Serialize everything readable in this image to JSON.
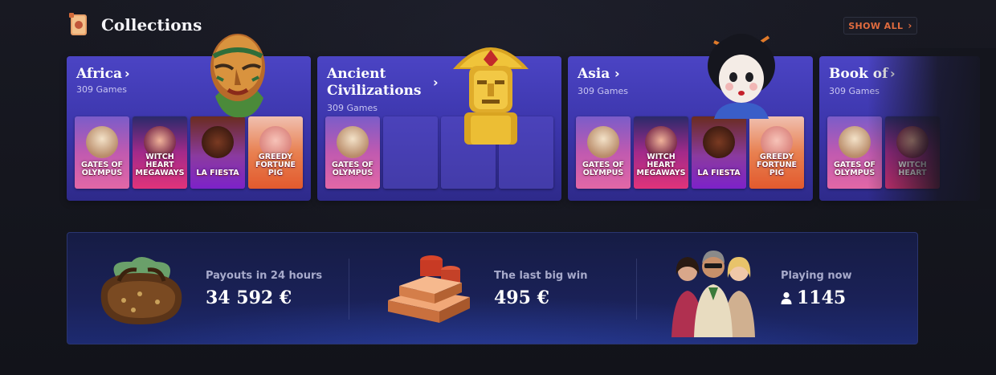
{
  "header": {
    "title": "Collections",
    "show_all_label": "SHOW ALL",
    "accent": "#e06b3e"
  },
  "collections": [
    {
      "title": "Africa",
      "count": "309 Games",
      "games": [
        "GATES OF OLYMPUS",
        "WITCH HEART MEGAWAYS",
        "LA FIESTA",
        "GREEDY FORTUNE PIG"
      ]
    },
    {
      "title": "Ancient Civilizations",
      "count": "309 Games",
      "games": [
        "GATES OF OLYMPUS"
      ]
    },
    {
      "title": "Asia",
      "count": "309 Games",
      "games": [
        "GATES OF OLYMPUS",
        "WITCH HEART MEGAWAYS",
        "LA FIESTA",
        "GREEDY FORTUNE PIG"
      ]
    },
    {
      "title": "Book of",
      "count": "309 Games",
      "games": [
        "GATES OF OLYMPUS",
        "WITCH HEART"
      ]
    }
  ],
  "stats": {
    "payouts": {
      "label": "Payouts in 24 hours",
      "value": "34 592 €"
    },
    "big_win": {
      "label": "The last big win",
      "value": "495 €"
    },
    "playing": {
      "label": "Playing now",
      "value": "1145",
      "icon": "user-icon"
    }
  }
}
